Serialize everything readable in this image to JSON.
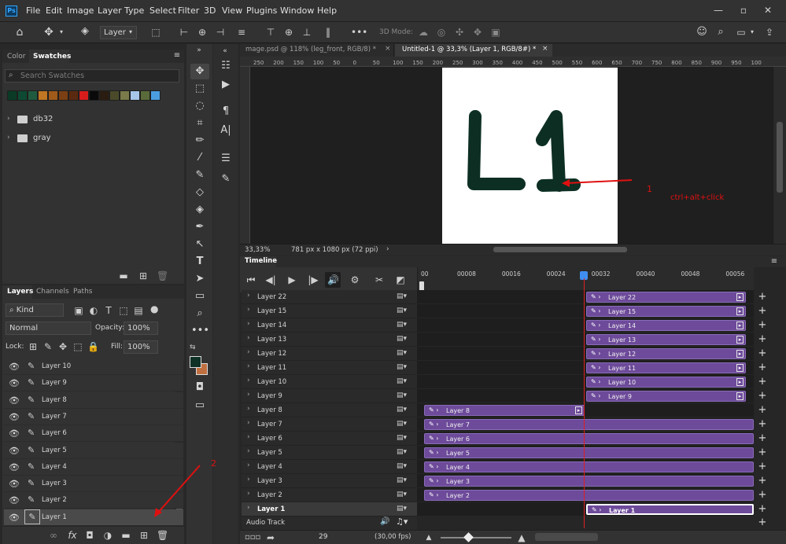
{
  "app": {
    "logo": "Ps"
  },
  "menu": [
    "File",
    "Edit",
    "Image",
    "Layer",
    "Type",
    "Select",
    "Filter",
    "3D",
    "View",
    "Plugins",
    "Window",
    "Help"
  ],
  "options": {
    "layer_select": "Layer",
    "mode3d": "3D Mode:"
  },
  "left_panel": {
    "tabs": [
      "Color",
      "Swatches"
    ],
    "search_placeholder": "Search Swatches",
    "swatches": [
      "#0b3a26",
      "#0e4a33",
      "#1f5a3f",
      "#c07622",
      "#a05a1a",
      "#7a3f13",
      "#5a2a10",
      "#d81c1c",
      "#0a0a0a",
      "#2a1c10",
      "#4a4a2a",
      "#7a7a4a",
      "#a7c5e8",
      "#5a6a3a",
      "#4a9ee0"
    ],
    "groups": [
      "db32",
      "gray"
    ]
  },
  "layers_panel": {
    "tabs": [
      "Layers",
      "Channels",
      "Paths"
    ],
    "kind": "Kind",
    "blend": "Normal",
    "opacity_label": "Opacity:",
    "opacity": "100%",
    "lock_label": "Lock:",
    "fill_label": "Fill:",
    "fill": "100%",
    "layers": [
      "Layer 10",
      "Layer 9",
      "Layer 8",
      "Layer 7",
      "Layer 6",
      "Layer 5",
      "Layer 4",
      "Layer 3",
      "Layer 2",
      "Layer 1"
    ]
  },
  "doc_tabs": [
    "mage.psd @ 118% (leg_front, RGB/8) *",
    "Untitled-1 @ 33,3% (Layer 1, RGB/8#) *"
  ],
  "ruler": [
    "250",
    "200",
    "150",
    "100",
    "50",
    "0",
    "50",
    "100",
    "150",
    "200",
    "250",
    "300",
    "350",
    "400",
    "450",
    "500",
    "550",
    "600",
    "650",
    "700",
    "750",
    "800",
    "850",
    "900",
    "950",
    "100"
  ],
  "canvas": {
    "drawing_text": "L1",
    "status_zoom": "33,33%",
    "status_info": "781 px x 1080 px (72 ppi)"
  },
  "annotations": {
    "one": "1",
    "two": "2",
    "hint": "ctrl+alt+click"
  },
  "timeline": {
    "title": "Timeline",
    "ticks": [
      "00",
      "00008",
      "00016",
      "00024",
      "00032",
      "00040",
      "00048",
      "00056"
    ],
    "tracks": [
      "Layer 22",
      "Layer 15",
      "Layer 14",
      "Layer 13",
      "Layer 12",
      "Layer 11",
      "Layer 10",
      "Layer 9",
      "Layer 8",
      "Layer 7",
      "Layer 6",
      "Layer 5",
      "Layer 4",
      "Layer 3",
      "Layer 2",
      "Layer 1"
    ],
    "audio": "Audio Track",
    "frame": "29",
    "fps": "(30,00 fps)"
  }
}
